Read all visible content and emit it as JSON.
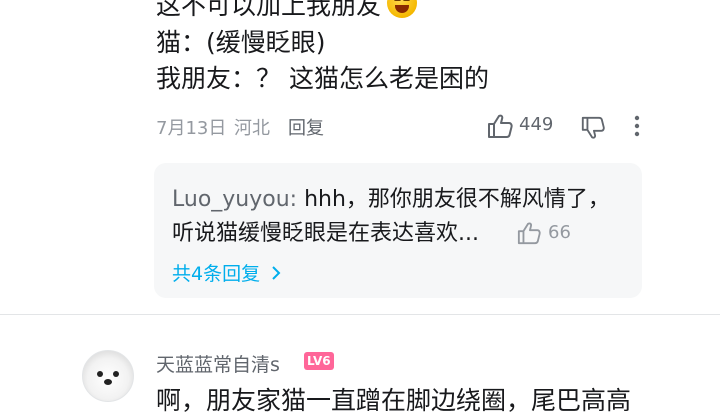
{
  "comment": {
    "lines": [
      "这不可以加上我朋友",
      "猫：(缓慢眨眼)",
      "我朋友：？ 这猫怎么老是困的"
    ],
    "emoji": "grinning-face-emoji",
    "date": "7月13日",
    "location": "河北",
    "reply_label": "回复",
    "like_count": "449"
  },
  "reply_preview": {
    "username": "Luo_yuyou",
    "text_line1": "hhh，那你朋友很不解风情了，",
    "text_line2": "听说猫缓慢眨眼是在表达喜欢...",
    "like_count": "66",
    "more_link": "共4条回复"
  },
  "next_comment": {
    "username": "天蓝蓝常自清s",
    "level_badge": "LV6",
    "text": "啊，朋友家猫一直蹭在脚边绕圈，尾巴高高"
  },
  "colors": {
    "link": "#00aeec",
    "level_badge": "#ff6699",
    "meta": "#9499a0"
  }
}
